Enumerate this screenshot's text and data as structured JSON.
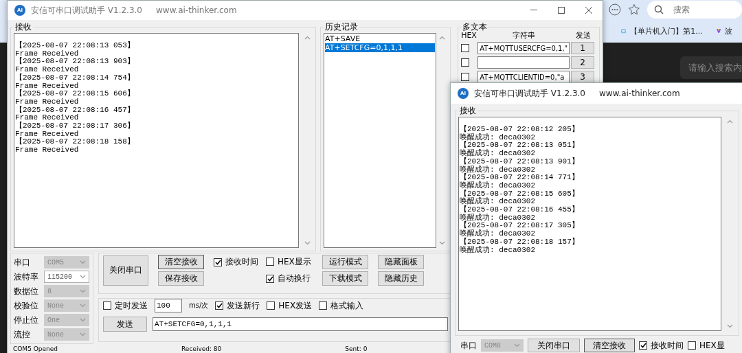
{
  "browser": {
    "search_placeholder": "搜索",
    "bookmarks": [
      {
        "label": "【单片机入门】第1...",
        "kind": "tv"
      },
      {
        "label": "波",
        "kind": "v"
      }
    ],
    "page_search_placeholder": "请输入搜索内"
  },
  "main_window": {
    "logo": "AI",
    "title": "安信可串口调试助手 V1.2.3.0",
    "url": "www.ai-thinker.com",
    "receive": {
      "label": "接收",
      "lines": [
        "【2025-08-07 22:08:13 053】",
        "Frame Received",
        "【2025-08-07 22:08:13 903】",
        "Frame Received",
        "【2025-08-07 22:08:14 754】",
        "Frame Received",
        "【2025-08-07 22:08:15 606】",
        "Frame Received",
        "【2025-08-07 22:08:16 457】",
        "Frame Received",
        "【2025-08-07 22:08:17 306】",
        "Frame Received",
        "【2025-08-07 22:08:18 158】",
        "Frame Received"
      ]
    },
    "history": {
      "label": "历史记录",
      "items": [
        {
          "text": "AT+SAVE",
          "selected": false
        },
        {
          "text": "AT+SETCFG=0,1,1,1",
          "selected": true
        }
      ]
    },
    "multi_text": {
      "label": "多文本",
      "headers": [
        "HEX",
        "字符串",
        "发送"
      ],
      "rows": [
        {
          "hex": false,
          "value": "AT+MQTTUSERCFG=0,1,\"",
          "button": "1"
        },
        {
          "hex": false,
          "button": "2"
        },
        {
          "hex": false,
          "value": "AT+MQTTCLIENTID=0,\"a",
          "button": "3"
        }
      ]
    },
    "serial": [
      {
        "label": "串口",
        "value": "COM5",
        "disabled": true
      },
      {
        "label": "波特率",
        "value": "115200",
        "disabled": false
      },
      {
        "label": "数据位",
        "value": "8",
        "disabled": true
      },
      {
        "label": "校验位",
        "value": "None",
        "disabled": true
      },
      {
        "label": "停止位",
        "value": "One",
        "disabled": true
      },
      {
        "label": "流控",
        "value": "None",
        "disabled": true
      }
    ],
    "controls": {
      "close_port": "关闭串口",
      "clear": "清空接收",
      "save": "保存接收",
      "checks": [
        {
          "label": "接收时间",
          "checked": true
        },
        {
          "label": "HEX显示",
          "checked": false
        },
        {
          "label": "自动换行",
          "checked": true
        }
      ],
      "run_mode": "运行模式",
      "download_mode": "下载模式",
      "hide_panel": "隐藏面板",
      "hide_history": "隐藏历史"
    },
    "send": {
      "timed": {
        "label": "定时发送",
        "checked": false
      },
      "interval": "100",
      "unit": "ms/次",
      "options": [
        {
          "label": "发送新行",
          "checked": true
        },
        {
          "label": "HEX发送",
          "checked": false
        },
        {
          "label": "格式输入",
          "checked": false
        }
      ],
      "button": "发送",
      "input": "AT+SETCFG=0,1,1,1"
    },
    "status_bar": [
      "COM5 Opened",
      "Received: 80",
      "Sent: 0"
    ]
  },
  "second_window": {
    "logo": "AI",
    "title": "安信可串口调试助手 V1.2.3.0",
    "url": "www.ai-thinker.com",
    "receive": {
      "label": "接收",
      "lines": [
        "【2025-08-07 22:08:12 205】",
        "唤醒成功: deca0302",
        "【2025-08-07 22:08:13 051】",
        "唤醒成功: deca0302",
        "【2025-08-07 22:08:13 901】",
        "唤醒成功: deca0302",
        "【2025-08-07 22:08:14 771】",
        "唤醒成功: deca0302",
        "【2025-08-07 22:08:15 605】",
        "唤醒成功: deca0302",
        "【2025-08-07 22:08:16 455】",
        "唤醒成功: deca0302",
        "【2025-08-07 22:08:17 305】",
        "唤醒成功: deca0302",
        "【2025-08-07 22:08:18 157】",
        "唤醒成功: deca0302"
      ]
    },
    "port": {
      "label": "串口",
      "value": "COM8",
      "disabled": true
    },
    "close_port": "关闭串口",
    "clear": "清空接收",
    "checks": [
      {
        "label": "接收时间",
        "checked": true
      },
      {
        "label": "HEX显",
        "checked": false
      }
    ]
  }
}
